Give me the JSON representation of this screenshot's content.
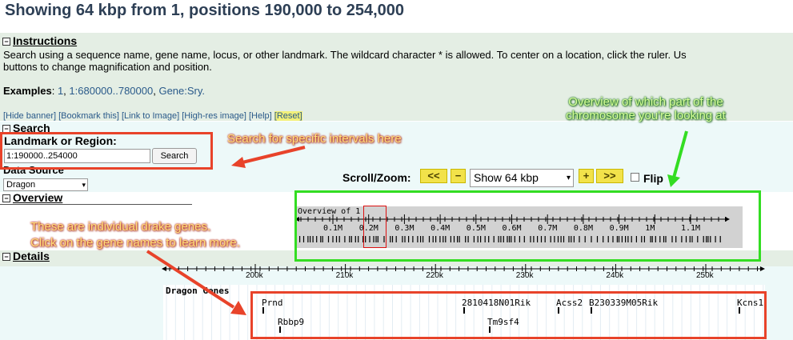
{
  "page": {
    "title": "Showing 64 kbp from 1, positions 190,000 to 254,000"
  },
  "instructions": {
    "heading": "Instructions",
    "text_line1": "Search using a sequence name, gene name, locus, or other landmark. The wildcard character * is allowed. To center on a location, click the ruler. Us",
    "text_line2": "buttons to change magnification and position.",
    "examples_label": "Examples",
    "examples": [
      "1",
      "1:680000..780000",
      "Gene:Sry."
    ]
  },
  "links": [
    "[Hide banner]",
    "[Bookmark this]",
    "[Link to Image]",
    "[High-res image]",
    "[Help]",
    "[Reset]"
  ],
  "search": {
    "heading": "Search",
    "landmark_label": "Landmark or Region:",
    "input_value": "1:190000..254000",
    "button_label": "Search",
    "data_source_label": "Data Source",
    "data_source_value": "Dragon"
  },
  "scroll": {
    "label": "Scroll/Zoom:",
    "left2": "<<",
    "left1": "<",
    "zoom_out": "−",
    "zoom_select": "Show 64 kbp",
    "zoom_in": "+",
    "right1": ">",
    "right2": ">>",
    "flip_label": "Flip",
    "flip_checked": false
  },
  "overview": {
    "heading": "Overview",
    "track_label": "Overview of 1",
    "ticks": [
      "0.1M",
      "0.2M",
      "0.3M",
      "0.4M",
      "0.5M",
      "0.6M",
      "0.7M",
      "0.8M",
      "0.9M",
      "1M",
      "1.1M"
    ]
  },
  "details": {
    "heading": "Details",
    "ticks": [
      "200k",
      "210k",
      "220k",
      "230k",
      "240k",
      "250k"
    ],
    "track_label": "Dragon Genes",
    "genes_row1": [
      "Prnd",
      "2810418N01Rik",
      "Acss2",
      "B230339M05Rik",
      "Kcns1"
    ],
    "genes_row2": [
      "Rbbp9",
      "Tm9sf4"
    ]
  },
  "annotations": {
    "search_callout": "Search for specific intervals here",
    "overview_callout_line1": "Overview of which part of the",
    "overview_callout_line2": "chromosome you're looking at",
    "genes_callout_line1": "These are individual drake genes.",
    "genes_callout_line2": "Click on the gene names to learn more."
  },
  "colors": {
    "title": "#2d3f55",
    "section_band": "#e4eee4",
    "panel": "#edf9f9",
    "link": "#2a5a8a",
    "reset_bg": "#f2f07a",
    "red_box": "#e8432a",
    "green_box": "#33dd22",
    "yellow_button": "#f2e24a"
  }
}
